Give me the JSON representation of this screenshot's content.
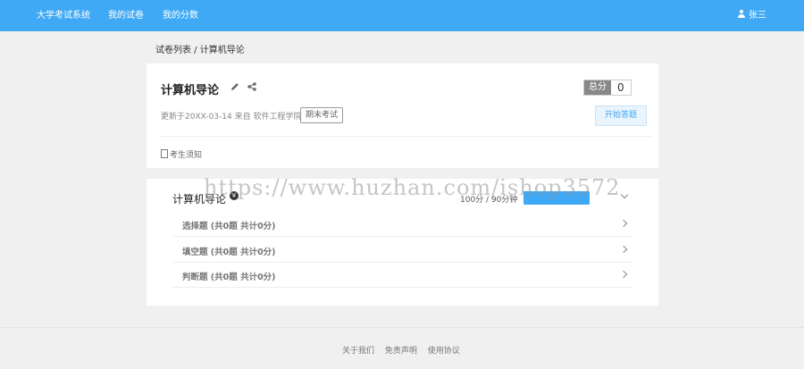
{
  "nav": {
    "brand": "大学考试系统",
    "items": [
      "我的试卷",
      "我的分数"
    ],
    "user": "张三"
  },
  "breadcrumb": "试卷列表 / 计算机导论",
  "exam": {
    "title": "计算机导论",
    "score_label": "总分",
    "score_value": "0",
    "meta": "更新于20XX-03-14   来自 软件工程学院",
    "badge": "期末考试",
    "start_button": "开始答题",
    "notice": "考生须知"
  },
  "section": {
    "title": "计算机导论",
    "icon": "¥",
    "stats": "100分 / 90分钟"
  },
  "question_groups": [
    "选择题 (共0题 共计0分)",
    "填空题 (共0题 共计0分)",
    "判断题 (共0题 共计0分)"
  ],
  "watermark": "https://www.huzhan.com/ishop3572",
  "footer": [
    "关于我们",
    "免责声明",
    "使用协议"
  ],
  "colors": {
    "accent": "#3fa9f5",
    "background": "#f0f0f0"
  }
}
